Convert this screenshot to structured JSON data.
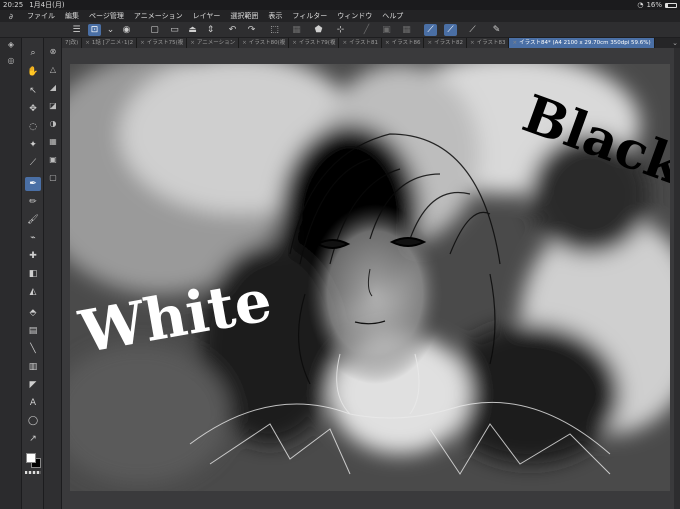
{
  "status": {
    "time": "20:25",
    "date": "1月4日(月)",
    "battery": "16%"
  },
  "menu": [
    "ファイル",
    "編集",
    "ページ管理",
    "アニメーション",
    "レイヤー",
    "選択範囲",
    "表示",
    "フィルター",
    "ウィンドウ",
    "ヘルプ"
  ],
  "tabs": [
    {
      "label": "7]改)",
      "active": false
    },
    {
      "label": "1話 [アニメ･1(2",
      "active": false
    },
    {
      "label": "イラスト75(複",
      "active": false
    },
    {
      "label": "アニメーション",
      "active": false
    },
    {
      "label": "イラスト80(複",
      "active": false
    },
    {
      "label": "イラスト79(複",
      "active": false
    },
    {
      "label": "イラスト81",
      "active": false
    },
    {
      "label": "イラスト86",
      "active": false
    },
    {
      "label": "イラスト82",
      "active": false
    },
    {
      "label": "イラスト83",
      "active": false
    },
    {
      "label": "イラスト84* (A4 2100 x 29.70cm 350dpi 59.6%)",
      "active": true
    }
  ],
  "artwork": {
    "text_left": "White",
    "text_right": "Black"
  }
}
